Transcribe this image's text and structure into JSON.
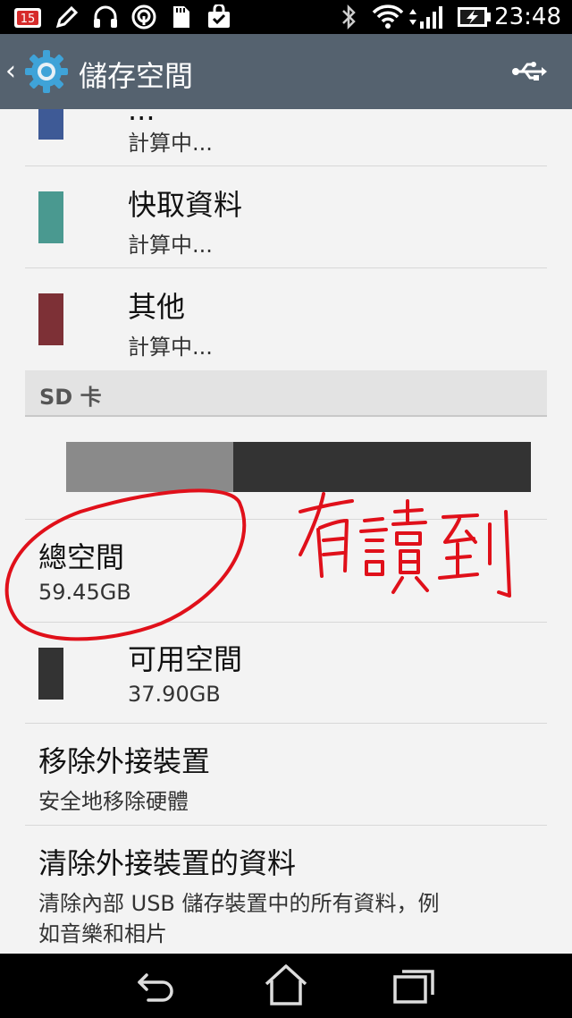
{
  "status_bar": {
    "notification_badge": "15",
    "time": "23:48",
    "icons": [
      "calendar-icon",
      "edit-icon",
      "headset-icon",
      "podcast-icon",
      "sd-card-icon",
      "shopping-bag-icon",
      "bluetooth-icon",
      "wifi-icon",
      "signal-icon",
      "battery-charging-icon"
    ]
  },
  "action_bar": {
    "title": "儲存空間",
    "usb_icon": "usb-icon"
  },
  "items": [
    {
      "title": "...",
      "subtitle": "計算中...",
      "color": "#3e5a96"
    },
    {
      "title": "快取資料",
      "subtitle": "計算中...",
      "color": "#4a9990"
    },
    {
      "title": "其他",
      "subtitle": "計算中...",
      "color": "#7d3036"
    }
  ],
  "section_header": "SD 卡",
  "usage_bar": {
    "used_fraction": 0.36,
    "used_color": "#8a8a8a",
    "free_color": "#333333"
  },
  "total_space": {
    "title": "總空間",
    "value": "59.45GB"
  },
  "available_space": {
    "title": "可用空間",
    "value": "37.90GB",
    "color": "#333333"
  },
  "unmount": {
    "title": "移除外接裝置",
    "subtitle": "安全地移除硬體"
  },
  "erase": {
    "title": "清除外接裝置的資料",
    "subtitle_line1": "清除內部 USB 儲存裝置中的所有資料，例",
    "subtitle_line2": "如音樂和相片"
  },
  "annotation": {
    "handwritten_text": "有讀到",
    "color": "#e0101a"
  },
  "nav_bar": {
    "buttons": [
      "back",
      "home",
      "recent-apps"
    ]
  }
}
